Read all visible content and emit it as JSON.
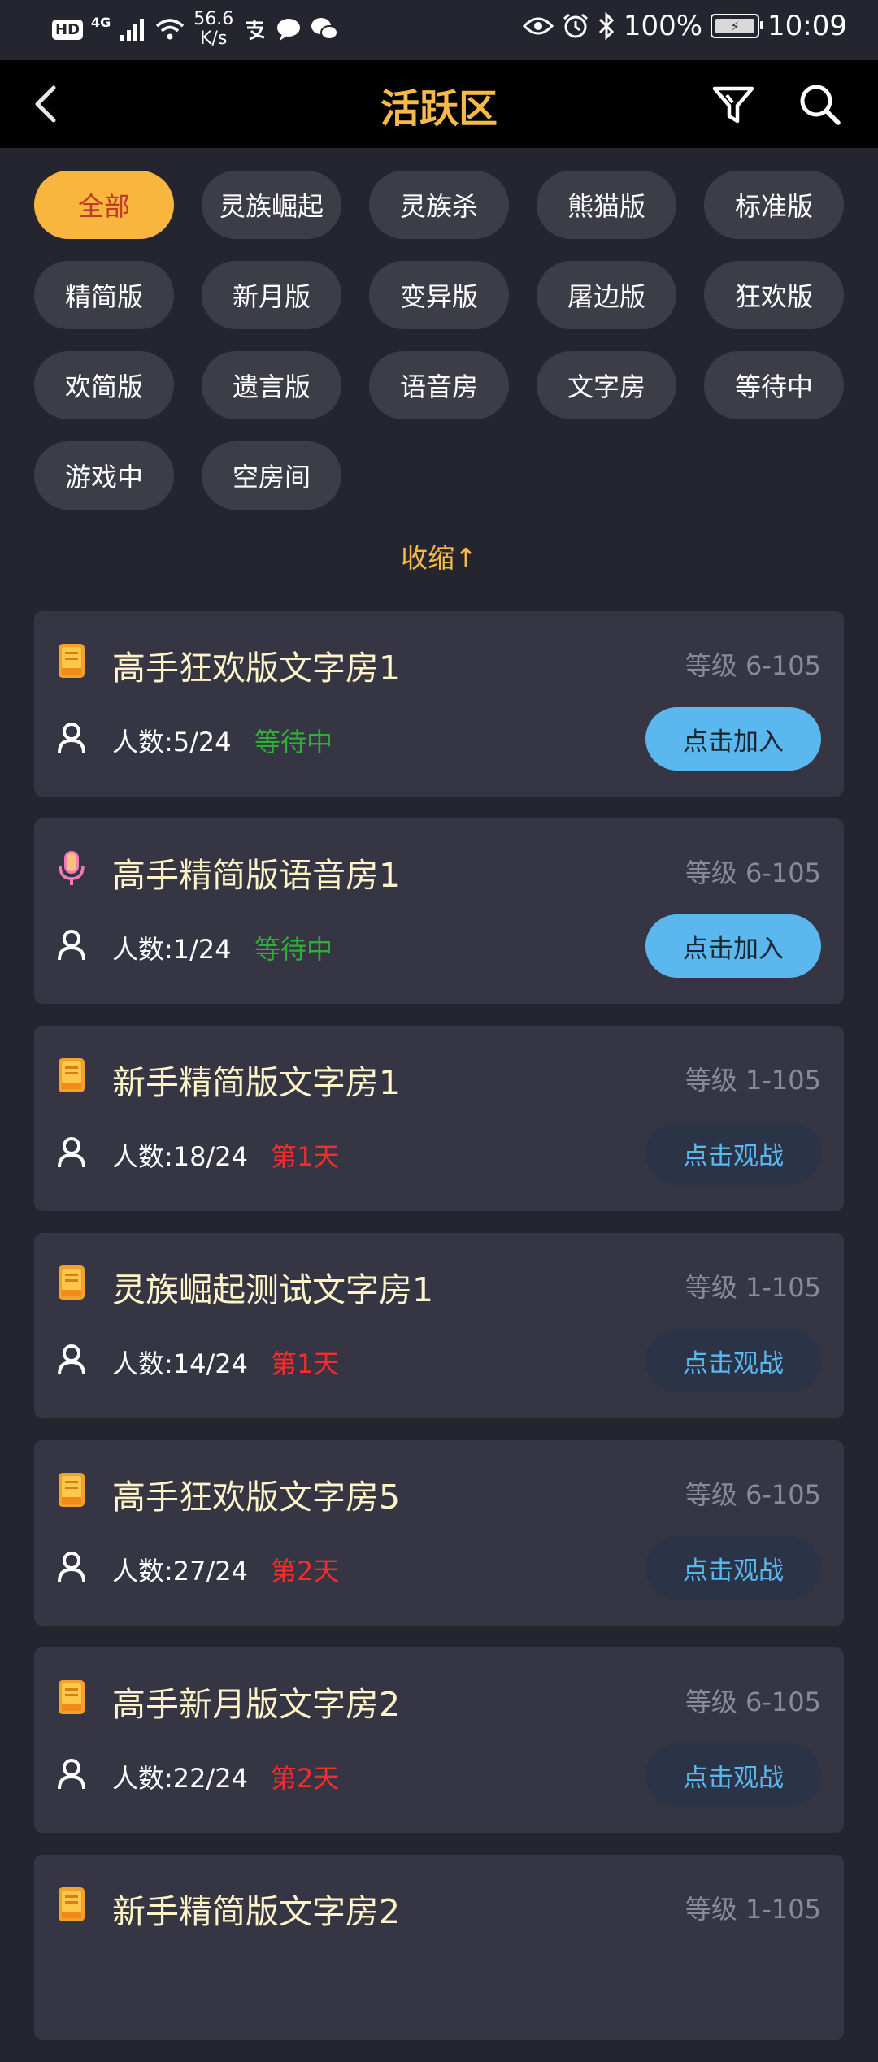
{
  "status_bar": {
    "hd": "HD",
    "network": "4G",
    "speed_value": "56.6",
    "speed_unit": "K/s",
    "battery": "100%",
    "time": "10:09"
  },
  "header": {
    "title": "活跃区"
  },
  "filters": {
    "chips": [
      "全部",
      "灵族崛起",
      "灵族杀",
      "熊猫版",
      "标准版",
      "精简版",
      "新月版",
      "变异版",
      "屠边版",
      "狂欢版",
      "欢简版",
      "遗言版",
      "语音房",
      "文字房",
      "等待中",
      "游戏中",
      "空房间"
    ],
    "active_index": 0,
    "collapse_label": "收缩↑"
  },
  "rooms": [
    {
      "title": "高手狂欢版文字房1",
      "level": "等级 6-105",
      "count": "人数:5/24",
      "status": "等待中",
      "status_type": "waiting",
      "action": "点击加入",
      "action_type": "join",
      "icon": "text-room-icon"
    },
    {
      "title": "高手精简版语音房1",
      "level": "等级 6-105",
      "count": "人数:1/24",
      "status": "等待中",
      "status_type": "waiting",
      "action": "点击加入",
      "action_type": "join",
      "icon": "voice-room-icon"
    },
    {
      "title": "新手精简版文字房1",
      "level": "等级 1-105",
      "count": "人数:18/24",
      "status": "第1天",
      "status_type": "day",
      "action": "点击观战",
      "action_type": "watch",
      "icon": "text-room-icon"
    },
    {
      "title": "灵族崛起测试文字房1",
      "level": "等级 1-105",
      "count": "人数:14/24",
      "status": "第1天",
      "status_type": "day",
      "action": "点击观战",
      "action_type": "watch",
      "icon": "text-room-icon"
    },
    {
      "title": "高手狂欢版文字房5",
      "level": "等级 6-105",
      "count": "人数:27/24",
      "status": "第2天",
      "status_type": "day",
      "action": "点击观战",
      "action_type": "watch",
      "icon": "text-room-icon"
    },
    {
      "title": "高手新月版文字房2",
      "level": "等级 6-105",
      "count": "人数:22/24",
      "status": "第2天",
      "status_type": "day",
      "action": "点击观战",
      "action_type": "watch",
      "icon": "text-room-icon"
    },
    {
      "title": "新手精简版文字房2",
      "level": "等级 1-105",
      "count": "",
      "status": "",
      "status_type": "day",
      "action": "",
      "action_type": "watch",
      "icon": "text-room-icon"
    }
  ],
  "colors": {
    "accent": "#f6b94a",
    "join_button": "#5ab8ee",
    "waiting": "#2fae36",
    "day": "#ff2a2a"
  }
}
